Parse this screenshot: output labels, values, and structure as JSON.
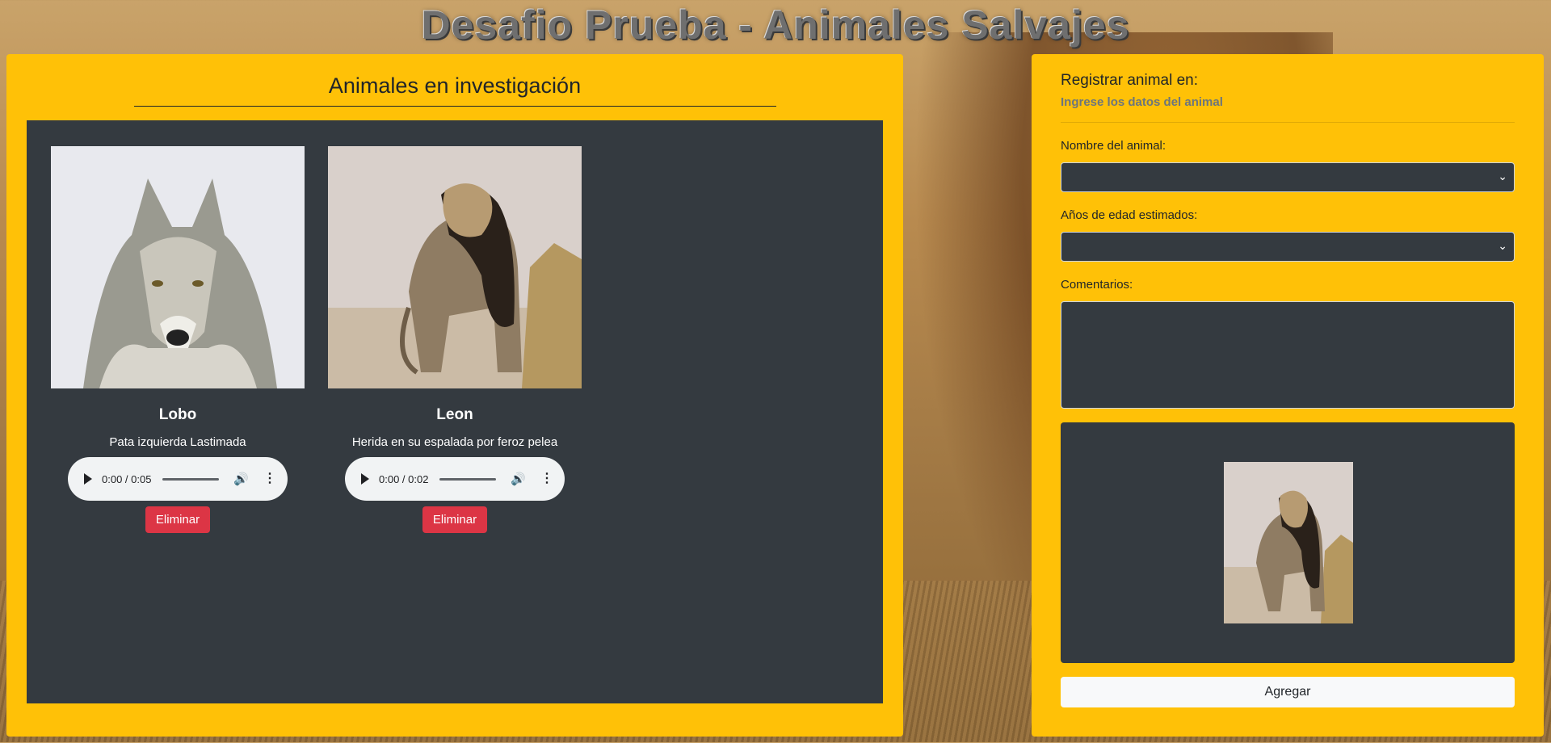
{
  "header": {
    "title": "Desafio Prueba - Animales Salvajes"
  },
  "left_panel": {
    "heading": "Animales en investigación",
    "cards": [
      {
        "name": "Lobo",
        "description": "Pata izquierda Lastimada",
        "audio": {
          "time": "0:00 / 0:05"
        },
        "delete_label": "Eliminar"
      },
      {
        "name": "Leon",
        "description": "Herida en su espalada por feroz pelea",
        "audio": {
          "time": "0:00 / 0:02"
        },
        "delete_label": "Eliminar"
      }
    ]
  },
  "form": {
    "title": "Registrar animal en:",
    "subtitle": "Ingrese los datos del animal",
    "name_label": "Nombre del animal:",
    "name_value": "",
    "age_label": "Años de edad estimados:",
    "age_value": "",
    "comments_label": "Comentarios:",
    "comments_value": "",
    "submit_label": "Agregar"
  },
  "colors": {
    "panel": "#ffc107",
    "dark": "#343a40",
    "danger": "#dc3545",
    "light": "#f8f9fa"
  },
  "icons": [
    "play-icon",
    "volume-icon",
    "more-options-icon",
    "chevron-down-icon"
  ]
}
